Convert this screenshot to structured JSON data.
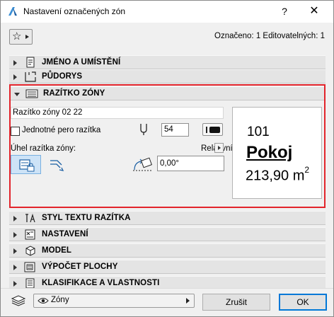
{
  "window": {
    "title": "Nastavení označených zón",
    "help_label": "?",
    "close_label": "✕"
  },
  "toolbar": {
    "favorites_icon": "star-icon",
    "status": "Označeno: 1 Editovatelných: 1"
  },
  "panels": {
    "name_location": "JMÉNO A UMÍSTĚNÍ",
    "floor_plan": "PŮDORYS",
    "zone_stamp": "RAZÍTKO ZÓNY",
    "stamp_text_style": "STYL TEXTU RAZÍTKA",
    "settings": "NASTAVENÍ",
    "model": "MODEL",
    "area_calculation": "VÝPOČET PLOCHY",
    "classification": "KLASIFIKACE A VLASTNOSTI"
  },
  "zone_stamp": {
    "stamp_name": "Razítko zóny 02 22",
    "uniform_pen_label": "Jednotné pero razítka",
    "uniform_pen_checked": false,
    "pen_value": "54",
    "angle_label": "Úhel razítka zóny:",
    "relative_label": "Relativní",
    "angle_value": "0,00°",
    "preview": {
      "number": "101",
      "name": "Pokoj",
      "area": "213,90 m",
      "area_unit_sup": "2"
    }
  },
  "footer": {
    "layer_value": "Zóny",
    "cancel_label": "Zrušit",
    "ok_label": "OK"
  },
  "colors": {
    "highlight_border": "#e2242b",
    "selected_button": "#cde3f7",
    "default_button_border": "#0078d7"
  }
}
